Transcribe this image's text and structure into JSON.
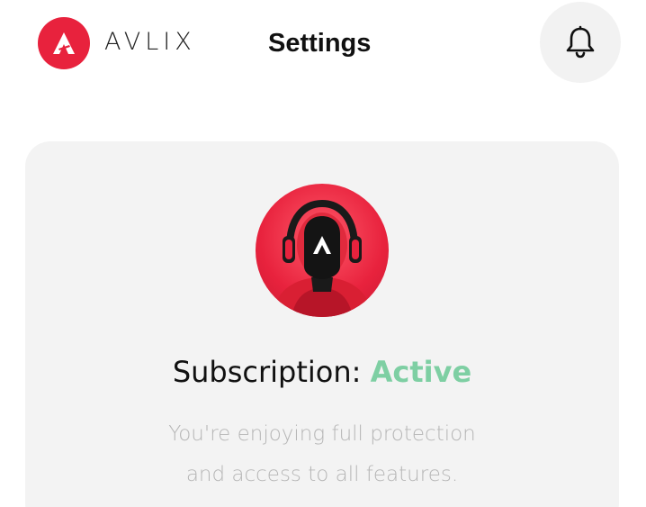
{
  "header": {
    "brand": "AVLIX",
    "title": "Settings",
    "logo_icon": "avlix-logo-icon",
    "notification_icon": "bell-icon"
  },
  "subscription": {
    "label": "Subscription: ",
    "status": "Active",
    "description_line1": "You're enjoying full protection",
    "description_line2": "and access to all features.",
    "avatar_icon": "avatar-helmet-icon"
  },
  "colors": {
    "brand_red": "#e8223d",
    "active_green": "#7ecfa3",
    "card_bg": "#f3f3f3",
    "muted_text": "#b6b6b6"
  }
}
